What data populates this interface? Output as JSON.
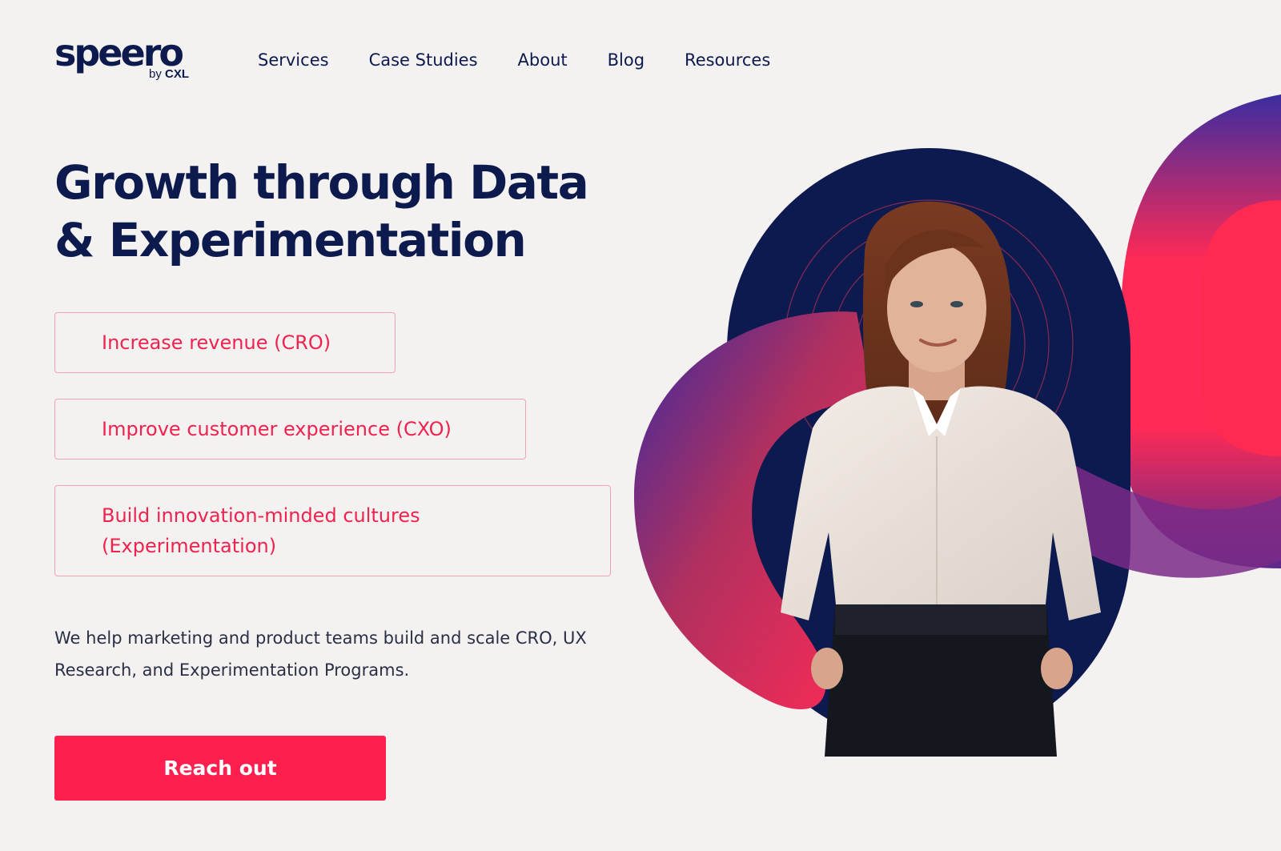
{
  "brand": {
    "name": "speero",
    "byline_prefix": "by",
    "byline_brand": "CXL"
  },
  "nav": {
    "items": [
      {
        "label": "Services"
      },
      {
        "label": "Case Studies"
      },
      {
        "label": "About"
      },
      {
        "label": "Blog"
      },
      {
        "label": "Resources"
      }
    ]
  },
  "hero": {
    "headline_line1": "Growth through Data",
    "headline_line2": "& Experimentation",
    "pills": [
      {
        "label": "Increase revenue (CRO)"
      },
      {
        "label": "Improve customer experience (CXO)"
      },
      {
        "label": "Build innovation-minded cultures (Experimentation)"
      }
    ],
    "description": "We help marketing and product teams build and scale CRO, UX Research, and Experimentation Programs.",
    "cta_label": "Reach out"
  },
  "colors": {
    "background": "#f4f2f1",
    "navy": "#0d1a4d",
    "accent": "#ff1f4f",
    "pill_border": "#f0a3b0"
  }
}
